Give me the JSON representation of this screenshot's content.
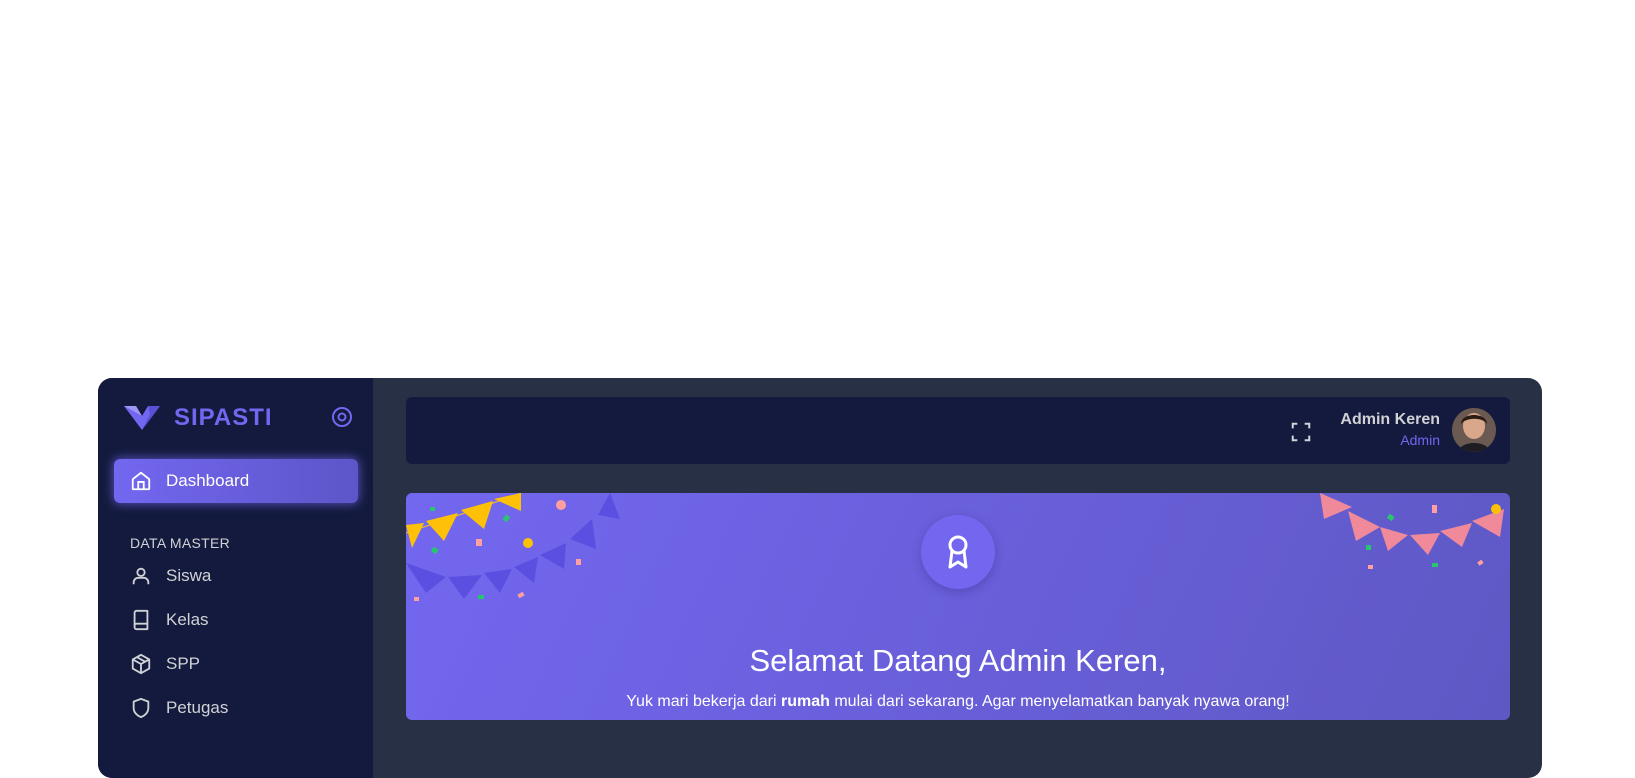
{
  "brand": {
    "name": "SIPASTI",
    "accent": "#7367f0"
  },
  "sidebar": {
    "active": {
      "label": "Dashboard",
      "icon": "home-icon"
    },
    "section_title": "DATA MASTER",
    "items": [
      {
        "label": "Siswa",
        "icon": "user-icon"
      },
      {
        "label": "Kelas",
        "icon": "book-icon"
      },
      {
        "label": "SPP",
        "icon": "box-icon"
      },
      {
        "label": "Petugas",
        "icon": "shield-icon"
      }
    ]
  },
  "header": {
    "user_name": "Admin Keren",
    "user_role": "Admin"
  },
  "banner": {
    "title": "Selamat Datang Admin Keren,",
    "text_before": "Yuk mari bekerja dari ",
    "text_bold": "rumah",
    "text_after": " mulai dari sekarang. Agar menyelamatkan banyak nyawa orang!"
  },
  "colors": {
    "sidebar_bg": "#131a3d",
    "body_bg": "#283046",
    "primary": "#7367f0"
  }
}
